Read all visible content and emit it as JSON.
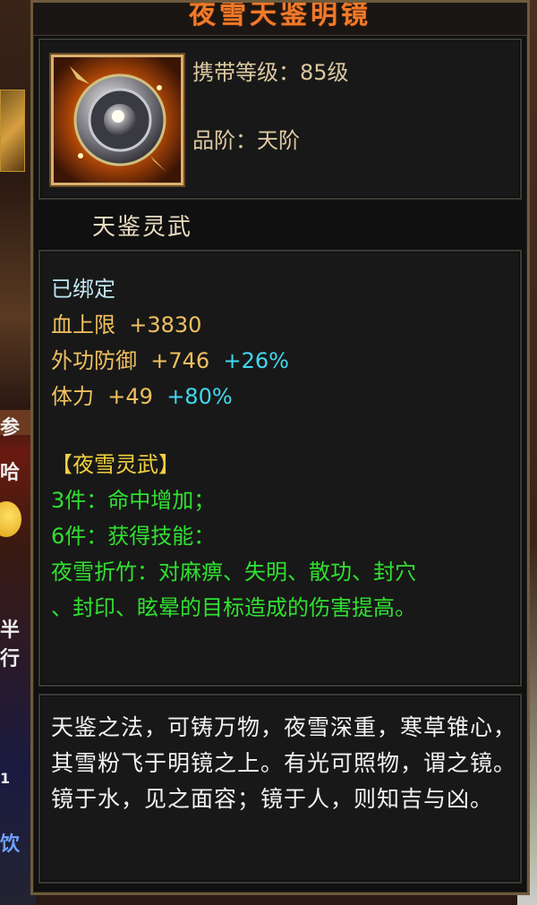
{
  "item": {
    "title": "夜雪天鉴明镜",
    "carry_level": "携带等级：85级",
    "grade": "品阶：天阶",
    "category": "天鉴灵武"
  },
  "stats": {
    "bound": "已绑定",
    "hp_label": "血上限",
    "hp_value": "+3830",
    "def_label": "外功防御",
    "def_value": "+746",
    "def_pct": "+26%",
    "sta_label": "体力",
    "sta_value": "+49",
    "sta_pct": "+80%"
  },
  "set": {
    "name": "【夜雪灵武】",
    "bonus3": "3件：命中增加；",
    "bonus6": "6件：获得技能：",
    "skill_line1": "夜雪折竹：对麻痹、失明、散功、封穴",
    "skill_line2": "、封印、眩晕的目标造成的伤害提高。"
  },
  "description": "天鉴之法，可铸万物，夜雪深重，寒草锥心，其雪粉飞于明镜之上。有光可照物，谓之镜。镜于水，见之面容；镜于人，则知吉与凶。",
  "background_snippets": {
    "a": "参",
    "b": "哈",
    "c": "半",
    "d": "行",
    "e": "1",
    "f": "饮"
  }
}
